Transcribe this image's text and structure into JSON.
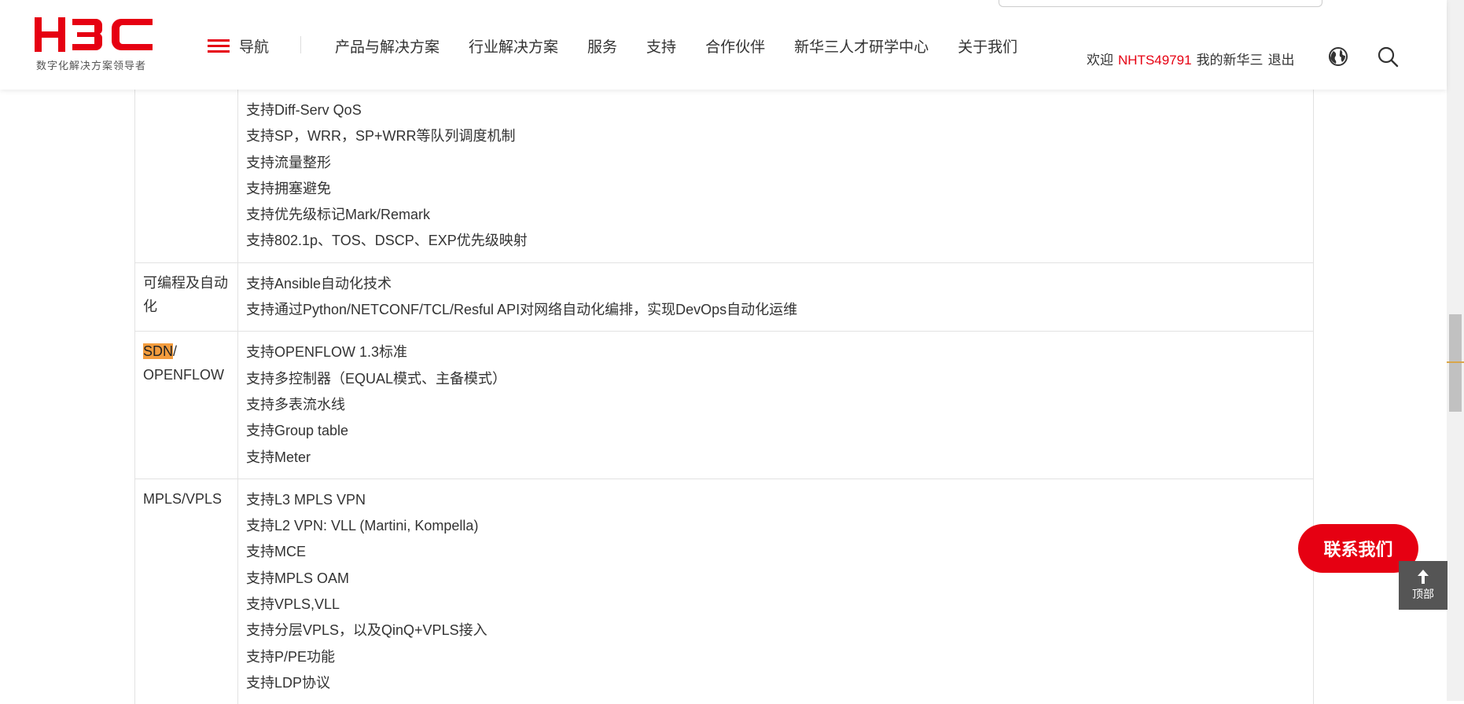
{
  "header": {
    "logo_text": "H3C",
    "logo_tagline": "数字化解决方案领导者",
    "nav_toggle_label": "导航",
    "menu": [
      {
        "label": "产品与解决方案"
      },
      {
        "label": "行业解决方案"
      },
      {
        "label": "服务"
      },
      {
        "label": "支持"
      },
      {
        "label": "合作伙伴"
      },
      {
        "label": "新华三人才研学中心"
      },
      {
        "label": "关于我们"
      }
    ],
    "user": {
      "welcome": "欢迎",
      "username": "NHTS49791",
      "my_account": "我的新华三",
      "logout": "退出"
    },
    "brand_color": "#e60012"
  },
  "table": {
    "rows": [
      {
        "label": "",
        "lines": [
          "支持Diff-Serv QoS",
          "支持SP，WRR，SP+WRR等队列调度机制",
          "支持流量整形",
          "支持拥塞避免",
          "支持优先级标记Mark/Remark",
          "支持802.1p、TOS、DSCP、EXP优先级映射"
        ]
      },
      {
        "label": "可编程及自动化",
        "lines": [
          "支持Ansible自动化技术",
          "支持通过Python/NETCONF/TCL/Resful API对网络自动化编排，实现DevOps自动化运维"
        ]
      },
      {
        "label_highlight": "SDN",
        "label_rest": "/",
        "label_line2": "OPENFLOW",
        "lines": [
          "支持OPENFLOW 1.3标准",
          "支持多控制器（EQUAL模式、主备模式）",
          "支持多表流水线",
          "支持Group table",
          "支持Meter"
        ]
      },
      {
        "label": "MPLS/VPLS",
        "lines": [
          "支持L3 MPLS VPN",
          "支持L2 VPN: VLL (Martini, Kompella)",
          "支持MCE",
          "支持MPLS OAM",
          "支持VPLS,VLL",
          "支持分层VPLS，以及QinQ+VPLS接入",
          "支持P/PE功能",
          "支持LDP协议"
        ]
      }
    ]
  },
  "widgets": {
    "contact_label": "联系我们",
    "top_label": "顶部"
  }
}
